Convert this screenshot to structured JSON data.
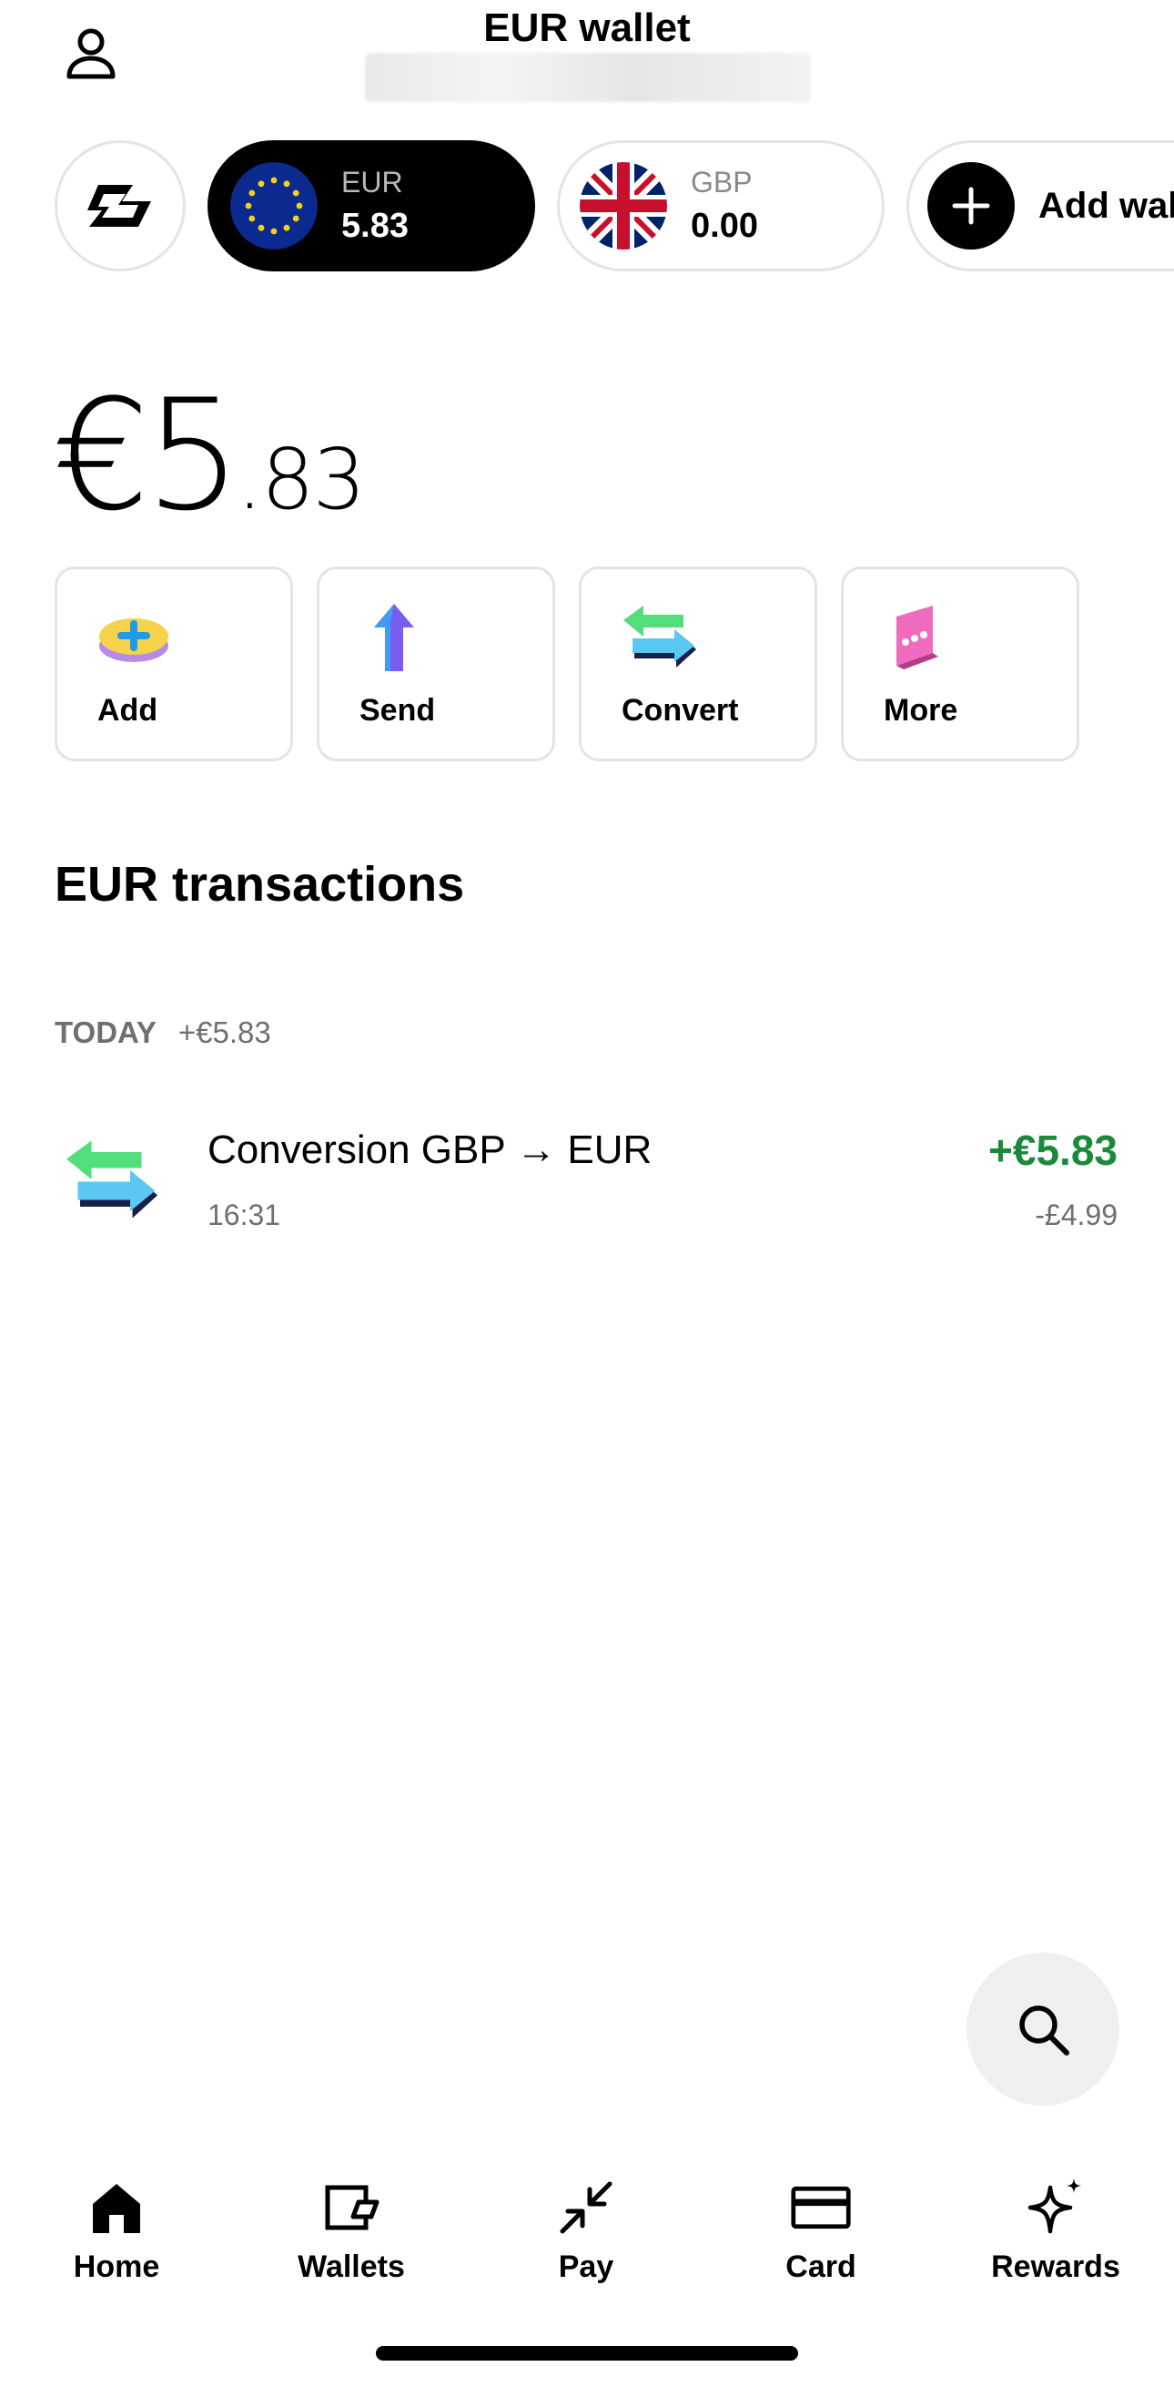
{
  "header": {
    "title": "EUR wallet",
    "icons": {
      "profile": "person-icon"
    }
  },
  "wallets": {
    "logo_icon": "brand-logo-icon",
    "items": [
      {
        "code": "EUR",
        "value": "5.83",
        "flag": "eu-flag-icon",
        "selected": true
      },
      {
        "code": "GBP",
        "value": "0.00",
        "flag": "uk-flag-icon",
        "selected": false
      }
    ],
    "add_label": "Add wallet"
  },
  "balance": {
    "currency": "€",
    "whole": "5",
    "cents": ".83"
  },
  "actions": [
    {
      "label": "Add",
      "icon": "add-money-icon"
    },
    {
      "label": "Send",
      "icon": "send-arrow-icon"
    },
    {
      "label": "Convert",
      "icon": "convert-arrows-icon"
    },
    {
      "label": "More",
      "icon": "more-dots-icon"
    }
  ],
  "transactions": {
    "title": "EUR transactions",
    "groups": [
      {
        "date": "TODAY",
        "total": "+€5.83",
        "items": [
          {
            "title": "Conversion GBP → EUR",
            "time": "16:31",
            "amount": "+€5.83",
            "sub_amount": "-£4.99",
            "icon": "convert-arrows-icon"
          }
        ]
      }
    ]
  },
  "search": {
    "icon": "search-icon"
  },
  "nav": [
    {
      "label": "Home",
      "icon": "home-icon",
      "active": true
    },
    {
      "label": "Wallets",
      "icon": "wallet-icon",
      "active": false
    },
    {
      "label": "Pay",
      "icon": "pay-arrows-icon",
      "active": false
    },
    {
      "label": "Card",
      "icon": "card-icon",
      "active": false
    },
    {
      "label": "Rewards",
      "icon": "sparkle-icon",
      "active": false
    }
  ],
  "colors": {
    "positive": "#1a8a3a",
    "muted": "#6f6f6f",
    "border": "#e4e4e4",
    "selected_pill": "#000000"
  }
}
